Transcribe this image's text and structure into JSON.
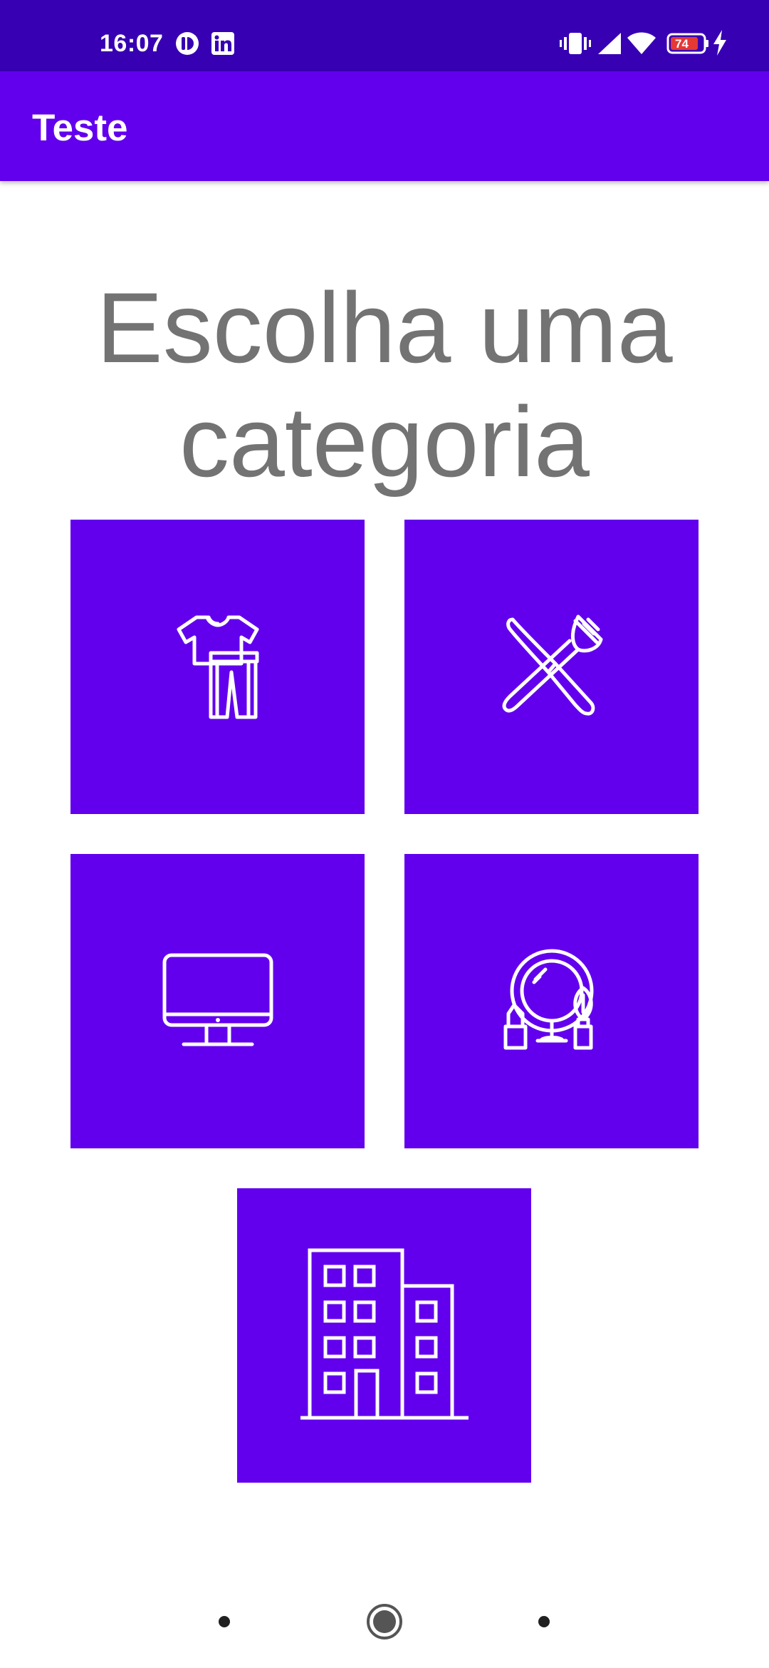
{
  "status_bar": {
    "time": "16:07",
    "battery_level": "74",
    "icons": [
      "notification-app-icon",
      "linkedin-icon",
      "vibrate-icon",
      "signal-icon",
      "wifi-icon",
      "battery-icon",
      "charging-icon"
    ]
  },
  "app_bar": {
    "title": "Teste"
  },
  "main": {
    "heading": "Escolha uma categoria",
    "categories": [
      {
        "icon": "clothing-icon"
      },
      {
        "icon": "cutlery-icon"
      },
      {
        "icon": "computer-monitor-icon"
      },
      {
        "icon": "cosmetics-icon"
      },
      {
        "icon": "building-icon"
      }
    ]
  },
  "nav_bar": {
    "icons": [
      "nav-back-dot",
      "nav-home-icon",
      "nav-recents-dot"
    ]
  },
  "colors": {
    "status_bar": "#3700b3",
    "primary": "#6200ee",
    "heading_text": "#737373",
    "background": "#ffffff"
  }
}
